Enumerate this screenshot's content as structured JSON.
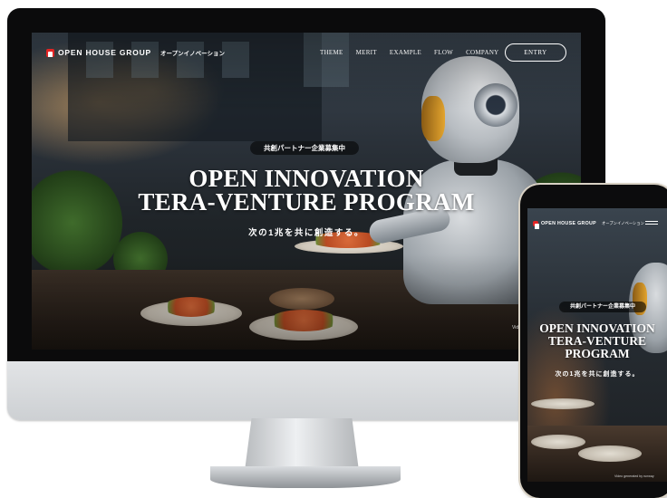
{
  "desktop": {
    "logo": {
      "brand": "OPEN HOUSE GROUP",
      "subtitle": "オープンイノベーション"
    },
    "nav": {
      "items": [
        "THEME",
        "MERIT",
        "EXAMPLE",
        "FLOW",
        "COMPANY"
      ],
      "entry": "ENTRY"
    },
    "hero": {
      "badge": "共創パートナー企業募集中",
      "title_line1": "OPEN INNOVATION",
      "title_line2": "TERA-VENTURE PROGRAM",
      "subtitle": "次の1兆を共に創造する。",
      "credit": "Video"
    }
  },
  "mobile": {
    "logo": {
      "brand": "OPEN HOUSE GROUP",
      "subtitle": "オープンイノベーション"
    },
    "hero": {
      "badge": "共創パートナー企業募集中",
      "title_line1": "OPEN INNOVATION",
      "title_line2": "TERA-VENTURE",
      "title_line3": "PROGRAM",
      "subtitle": "次の1兆を共に創造する。",
      "credit": "Video generated by runway"
    }
  },
  "colors": {
    "brand_red": "#e32424",
    "screen_dark": "#1f2428",
    "bezel": "#0b0b0c"
  },
  "icons": {
    "logo": "house-logo-icon",
    "menu": "hamburger-menu-icon"
  }
}
